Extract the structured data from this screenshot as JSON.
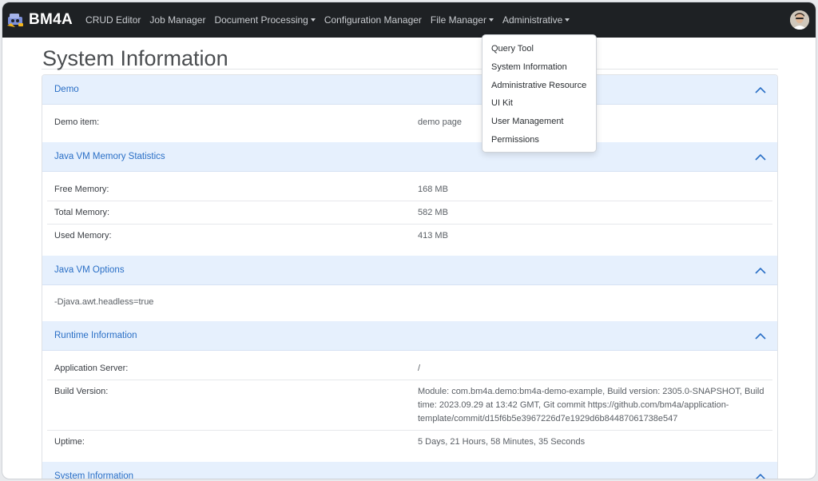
{
  "navbar": {
    "brand": "BM4A",
    "items": [
      {
        "label": "CRUD Editor",
        "dropdown": false
      },
      {
        "label": "Job Manager",
        "dropdown": false
      },
      {
        "label": "Document Processing",
        "dropdown": true
      },
      {
        "label": "Configuration Manager",
        "dropdown": false
      },
      {
        "label": "File Manager",
        "dropdown": true
      },
      {
        "label": "Administrative",
        "dropdown": true
      }
    ]
  },
  "page": {
    "title": "System Information"
  },
  "administrative_menu": {
    "items": [
      "Query Tool",
      "System Information",
      "Administrative Resource",
      "UI Kit",
      "User Management",
      "Permissions"
    ]
  },
  "sections": {
    "demo": {
      "title": "Demo",
      "rows": [
        {
          "key": "Demo item:",
          "value": "demo page"
        }
      ]
    },
    "memory": {
      "title": "Java VM Memory Statistics",
      "rows": [
        {
          "key": "Free Memory:",
          "value": "168 MB"
        },
        {
          "key": "Total Memory:",
          "value": "582 MB"
        },
        {
          "key": "Used Memory:",
          "value": "413 MB"
        }
      ]
    },
    "vm_options": {
      "title": "Java VM Options",
      "text": "-Djava.awt.headless=true"
    },
    "runtime": {
      "title": "Runtime Information",
      "rows": [
        {
          "key": "Application Server:",
          "value": "/"
        },
        {
          "key": "Build Version:",
          "value": "Module: com.bm4a.demo:bm4a-demo-example, Build version: 2305.0-SNAPSHOT, Build time: 2023.09.29 at 13:42 GMT, Git commit https://github.com/bm4a/application-template/commit/d15f6b5e3967226d7e1929d6b84487061738e547"
        },
        {
          "key": "Uptime:",
          "value": "5 Days, 21 Hours, 58 Minutes, 35 Seconds"
        }
      ]
    },
    "system": {
      "title": "System Information"
    }
  },
  "colors": {
    "navbar_bg": "#1e2124",
    "section_header_bg": "#e6f0fd",
    "section_header_text": "#2a6fc6"
  },
  "icons": {
    "brand": "bm4a-logo-icon",
    "section_toggle": "chevron-up-icon",
    "dropdown": "caret-down-icon"
  }
}
